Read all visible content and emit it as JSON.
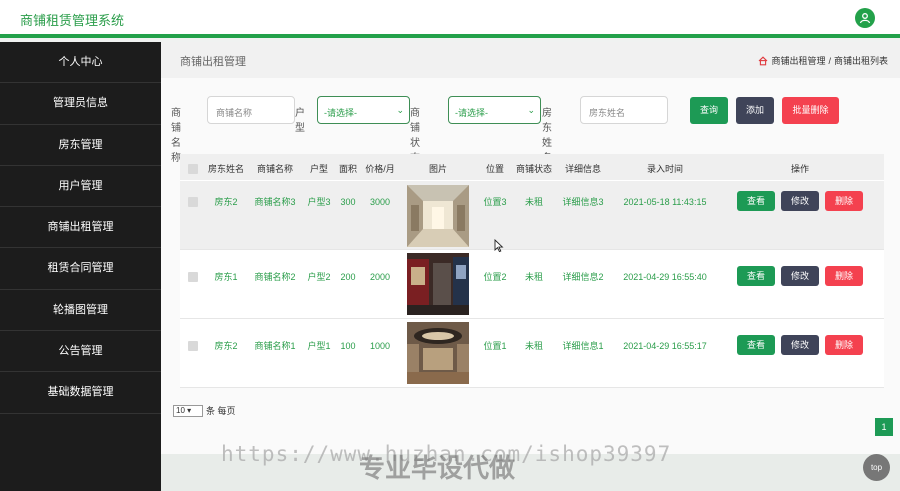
{
  "app": {
    "title": "商铺租赁管理系统"
  },
  "colors": {
    "accent": "#23a14a",
    "sidebar": "#1c1c1c",
    "primary_button": "#1d9a55",
    "dark_button": "#3f4459",
    "danger_button": "#f4414f"
  },
  "header": {
    "avatar_icon": "user-icon"
  },
  "sidebar": {
    "items": [
      {
        "label": "个人中心"
      },
      {
        "label": "管理员信息"
      },
      {
        "label": "房东管理"
      },
      {
        "label": "用户管理"
      },
      {
        "label": "商铺出租管理"
      },
      {
        "label": "租赁合同管理"
      },
      {
        "label": "轮播图管理"
      },
      {
        "label": "公告管理"
      },
      {
        "label": "基础数据管理"
      }
    ]
  },
  "page": {
    "title": "商铺出租管理",
    "breadcrumb": [
      "商铺出租管理",
      "商铺出租列表"
    ],
    "breadcrumb_sep": "/"
  },
  "search": {
    "name_label": "商铺名称",
    "name_placeholder": "商铺名称",
    "type_label": "户型",
    "type_value": "-请选择-",
    "status_label": "商铺状态",
    "status_value": "-请选择-",
    "landlord_label": "房东姓名",
    "landlord_placeholder": "房东姓名",
    "query_button": "查询",
    "add_button": "添加",
    "batch_delete_button": "批量删除"
  },
  "table": {
    "columns": [
      "房东姓名",
      "商铺名称",
      "户型",
      "面积",
      "价格/月",
      "图片",
      "位置",
      "商铺状态",
      "详细信息",
      "录入时间",
      "操作"
    ],
    "rows": [
      {
        "landlord": "房东2",
        "name": "商铺名称3",
        "type": "户型3",
        "area": "300",
        "price": "3000",
        "location": "位置3",
        "status": "未租",
        "detail": "详细信息3",
        "time": "2021-05-18 11:43:15"
      },
      {
        "landlord": "房东1",
        "name": "商铺名称2",
        "type": "户型2",
        "area": "200",
        "price": "2000",
        "location": "位置2",
        "status": "未租",
        "detail": "详细信息2",
        "time": "2021-04-29 16:55:40"
      },
      {
        "landlord": "房东2",
        "name": "商铺名称1",
        "type": "户型1",
        "area": "100",
        "price": "1000",
        "location": "位置1",
        "status": "未租",
        "detail": "详细信息1",
        "time": "2021-04-29 16:55:17"
      }
    ],
    "actions": {
      "view": "查看",
      "edit": "修改",
      "delete": "删除"
    }
  },
  "pager": {
    "page_size": "10",
    "per_page_label": "条 每页",
    "current_page": "1"
  },
  "overlay": {
    "watermark_url": "https://www.huzhan.com/ishop39397",
    "watermark_text": "专业毕设代做",
    "top_button": "top"
  }
}
